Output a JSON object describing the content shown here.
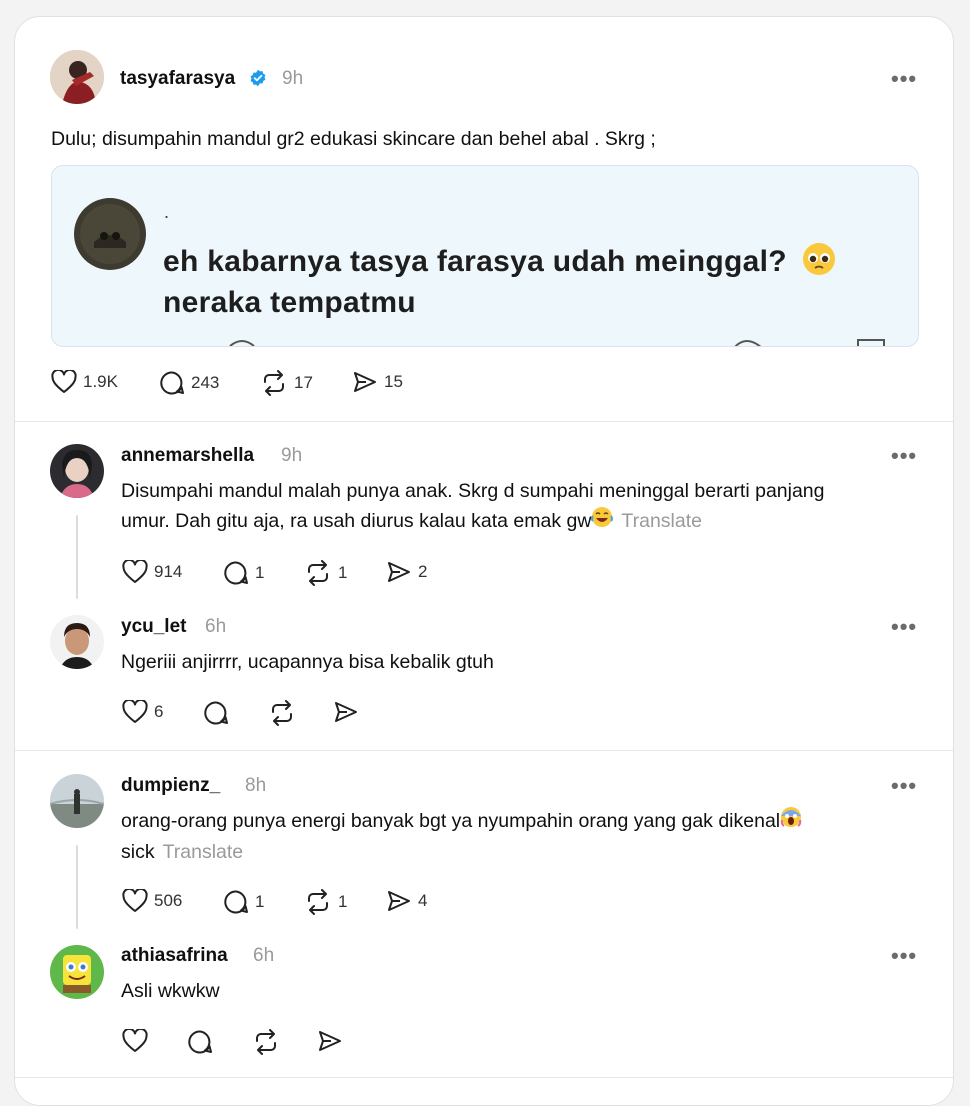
{
  "post": {
    "username": "tasyafarasya",
    "time": "9h",
    "text": "Dulu; disumpahin mandul gr2 edukasi skincare dan behel abal . Skrg ;",
    "quote": {
      "dot": ".",
      "line1": "eh kabarnya tasya farasya udah meinggal?",
      "line2": "neraka tempatmu"
    },
    "likes": "1.9K",
    "replies": "243",
    "reposts": "17",
    "shares": "15"
  },
  "comments": [
    {
      "username": "annemarshella",
      "time": "9h",
      "line1": "Disumpahi mandul malah punya anak. Skrg d sumpahi meninggal berarti panjang",
      "line2": "umur. Dah gitu aja, ra usah diurus kalau kata emak gw",
      "translate": "Translate",
      "likes": "914",
      "replies": "1",
      "reposts": "1",
      "shares": "2"
    },
    {
      "username": "ycu_let",
      "time": "6h",
      "line1": "Ngeriii anjirrrr, ucapannya bisa kebalik gtuh",
      "likes": "6"
    },
    {
      "username": "dumpienz_",
      "time": "8h",
      "line1": "orang-orang punya energi banyak bgt ya nyumpahin orang yang gak dikenal",
      "line2": "sick",
      "translate": "Translate",
      "likes": "506",
      "replies": "1",
      "reposts": "1",
      "shares": "4"
    },
    {
      "username": "athiasafrina",
      "time": "6h",
      "line1": "Asli wkwkw"
    }
  ],
  "colors": {
    "verified": "#1d9bf0",
    "quote_bg": "#eef7fb",
    "muted": "#9a9a9a"
  }
}
